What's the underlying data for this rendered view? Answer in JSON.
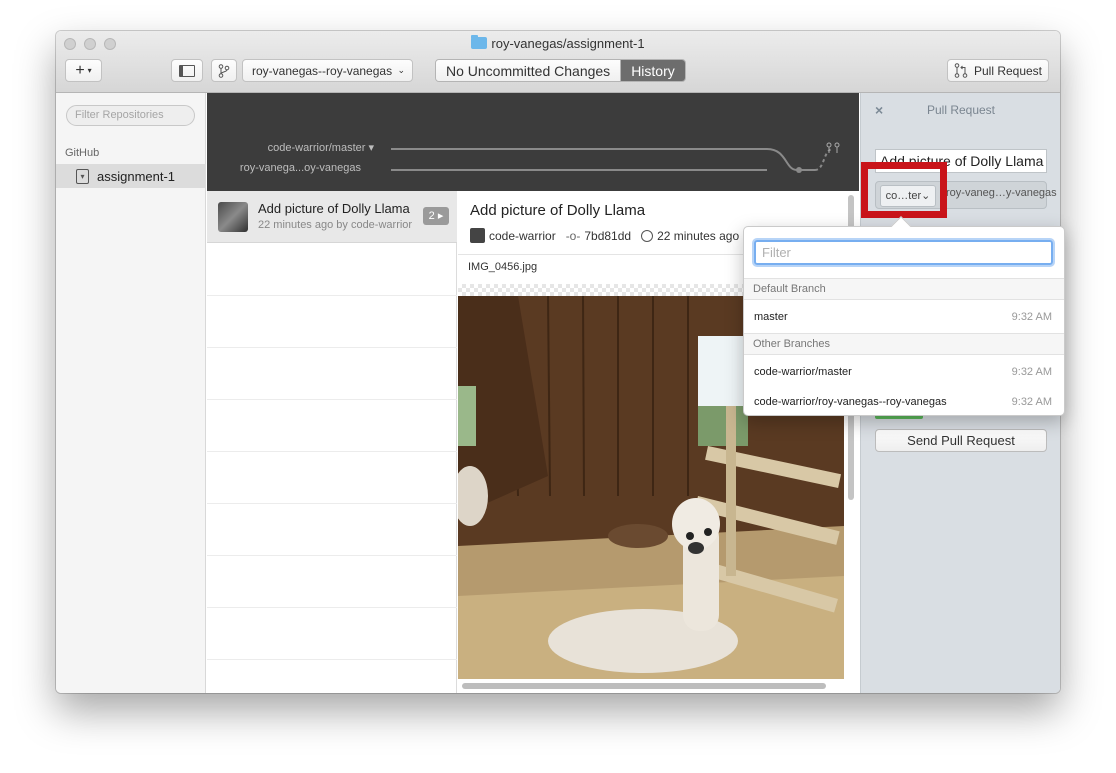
{
  "window": {
    "title": "roy-vanegas/assignment-1"
  },
  "toolbar": {
    "add_label": "+",
    "branch_selector": "roy-vanegas--roy-vanegas",
    "tab_changes": "No Uncommitted Changes",
    "tab_history": "History",
    "pull_request_label": "Pull Request"
  },
  "sidebar": {
    "filter_placeholder": "Filter Repositories",
    "section_label": "GitHub",
    "repo_label": "assignment-1"
  },
  "graph": {
    "branch_a": "code-warrior/master ▾",
    "branch_b": "roy-vanega...oy-vanegas"
  },
  "commits": [
    {
      "title": "Add picture of Dolly Llama",
      "meta": "22 minutes ago by code-warrior",
      "badge": "2 ▸"
    }
  ],
  "detail": {
    "title": "Add picture of Dolly Llama",
    "author": "code-warrior",
    "sha": "7bd81dd",
    "time": "22 minutes ago",
    "filename": "IMG_0456.jpg"
  },
  "pr_panel": {
    "close_label": "×",
    "title": "Pull Request",
    "pr_title": "Add picture of Dolly Llama",
    "from_branch": "co…ter",
    "to_branch": "roy-vaneg…y-vanegas",
    "send_label": "Send Pull Request"
  },
  "popover": {
    "filter_placeholder": "Filter",
    "default_header": "Default Branch",
    "default_items": [
      {
        "name": "master",
        "time": "9:32 AM"
      }
    ],
    "other_header": "Other Branches",
    "other_items": [
      {
        "name": "code-warrior/master",
        "time": "9:32 AM"
      },
      {
        "name": "code-warrior/roy-vanegas--roy-vanegas",
        "time": "9:32 AM"
      }
    ]
  },
  "colors": {
    "highlight_box": "#c9141a",
    "focus_ring": "#77aef0",
    "graph_bg": "#3c3c3c"
  }
}
